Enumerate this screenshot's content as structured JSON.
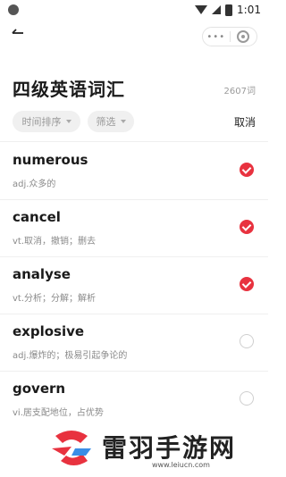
{
  "status_bar": {
    "time": "1:01"
  },
  "header": {
    "back_icon": "back-arrow-icon",
    "menu_dots": "•••",
    "title": "四级英语词汇",
    "count": "2607词"
  },
  "filters": {
    "sort_label": "时间排序",
    "filter_label": "筛选",
    "cancel_label": "取消"
  },
  "words": [
    {
      "word": "numerous",
      "meaning": "adj.众多的",
      "checked": true
    },
    {
      "word": "cancel",
      "meaning": "vt.取消，撤销；删去",
      "checked": true
    },
    {
      "word": "analyse",
      "meaning": "vt.分析；分解；解析",
      "checked": true
    },
    {
      "word": "explosive",
      "meaning": "adj.爆炸的；极易引起争论的",
      "checked": false
    },
    {
      "word": "govern",
      "meaning": "vi.居支配地位，占优势",
      "checked": false
    }
  ],
  "watermark": {
    "brand": "雷羽手游网",
    "url": "www.leiucn.com"
  },
  "colors": {
    "accent": "#e8323f",
    "text": "#1a1a1a",
    "muted": "#8a8a8a"
  }
}
